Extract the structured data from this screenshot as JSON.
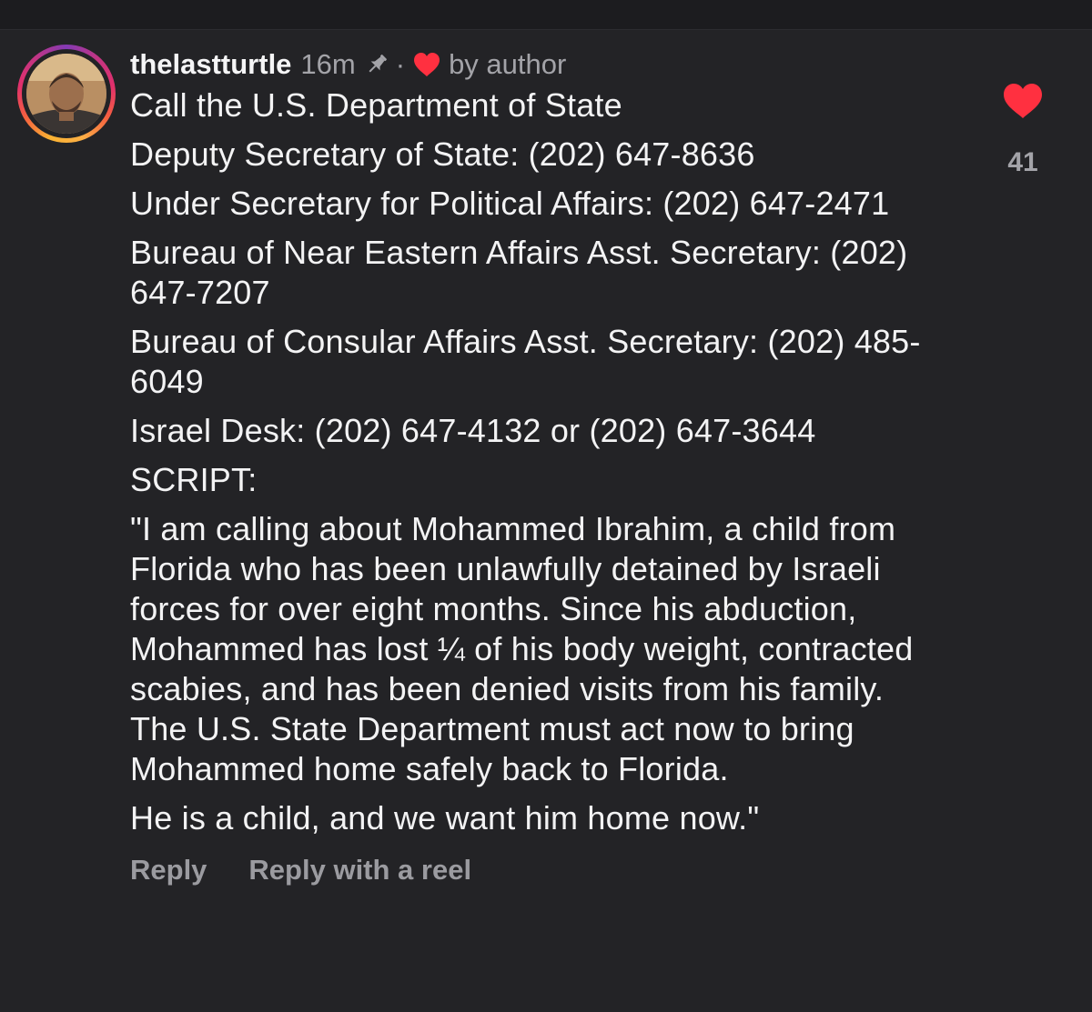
{
  "comment": {
    "username": "thelastturtle",
    "timestamp": "16m",
    "dot": "·",
    "by_author": "by author",
    "paragraphs": [
      "Call the U.S. Department of State",
      "Deputy Secretary of State: (202) 647-8636",
      "Under Secretary for Political Affairs: (202) 647-2471",
      "Bureau of Near Eastern Affairs Asst. Secretary: (202) 647-7207",
      "Bureau of Consular Affairs Asst. Secretary: (202) 485-6049",
      "Israel Desk: (202) 647-4132 or (202) 647-3644",
      "SCRIPT:",
      "\"I am calling about Mohammed Ibrahim, a child from Florida who has been unlawfully detained by Israeli forces for over eight months. Since his abduction, Mohammed has lost ¼ of his body weight, contracted scabies, and has been denied visits from his family. The U.S. State Department must act now to bring Mohammed home safely back to Florida.",
      "He is a child, and we want him home now.\""
    ],
    "actions": {
      "reply": "Reply",
      "reply_with_reel": "Reply with a reel"
    },
    "likes": "41"
  },
  "icons": {
    "pin": "pin-icon",
    "liked_by_author": "heart-icon",
    "like": "heart-icon"
  },
  "colors": {
    "background": "#232326",
    "text": "#f3f3f4",
    "muted": "#a3a3a8",
    "heart": "#ff3040"
  }
}
